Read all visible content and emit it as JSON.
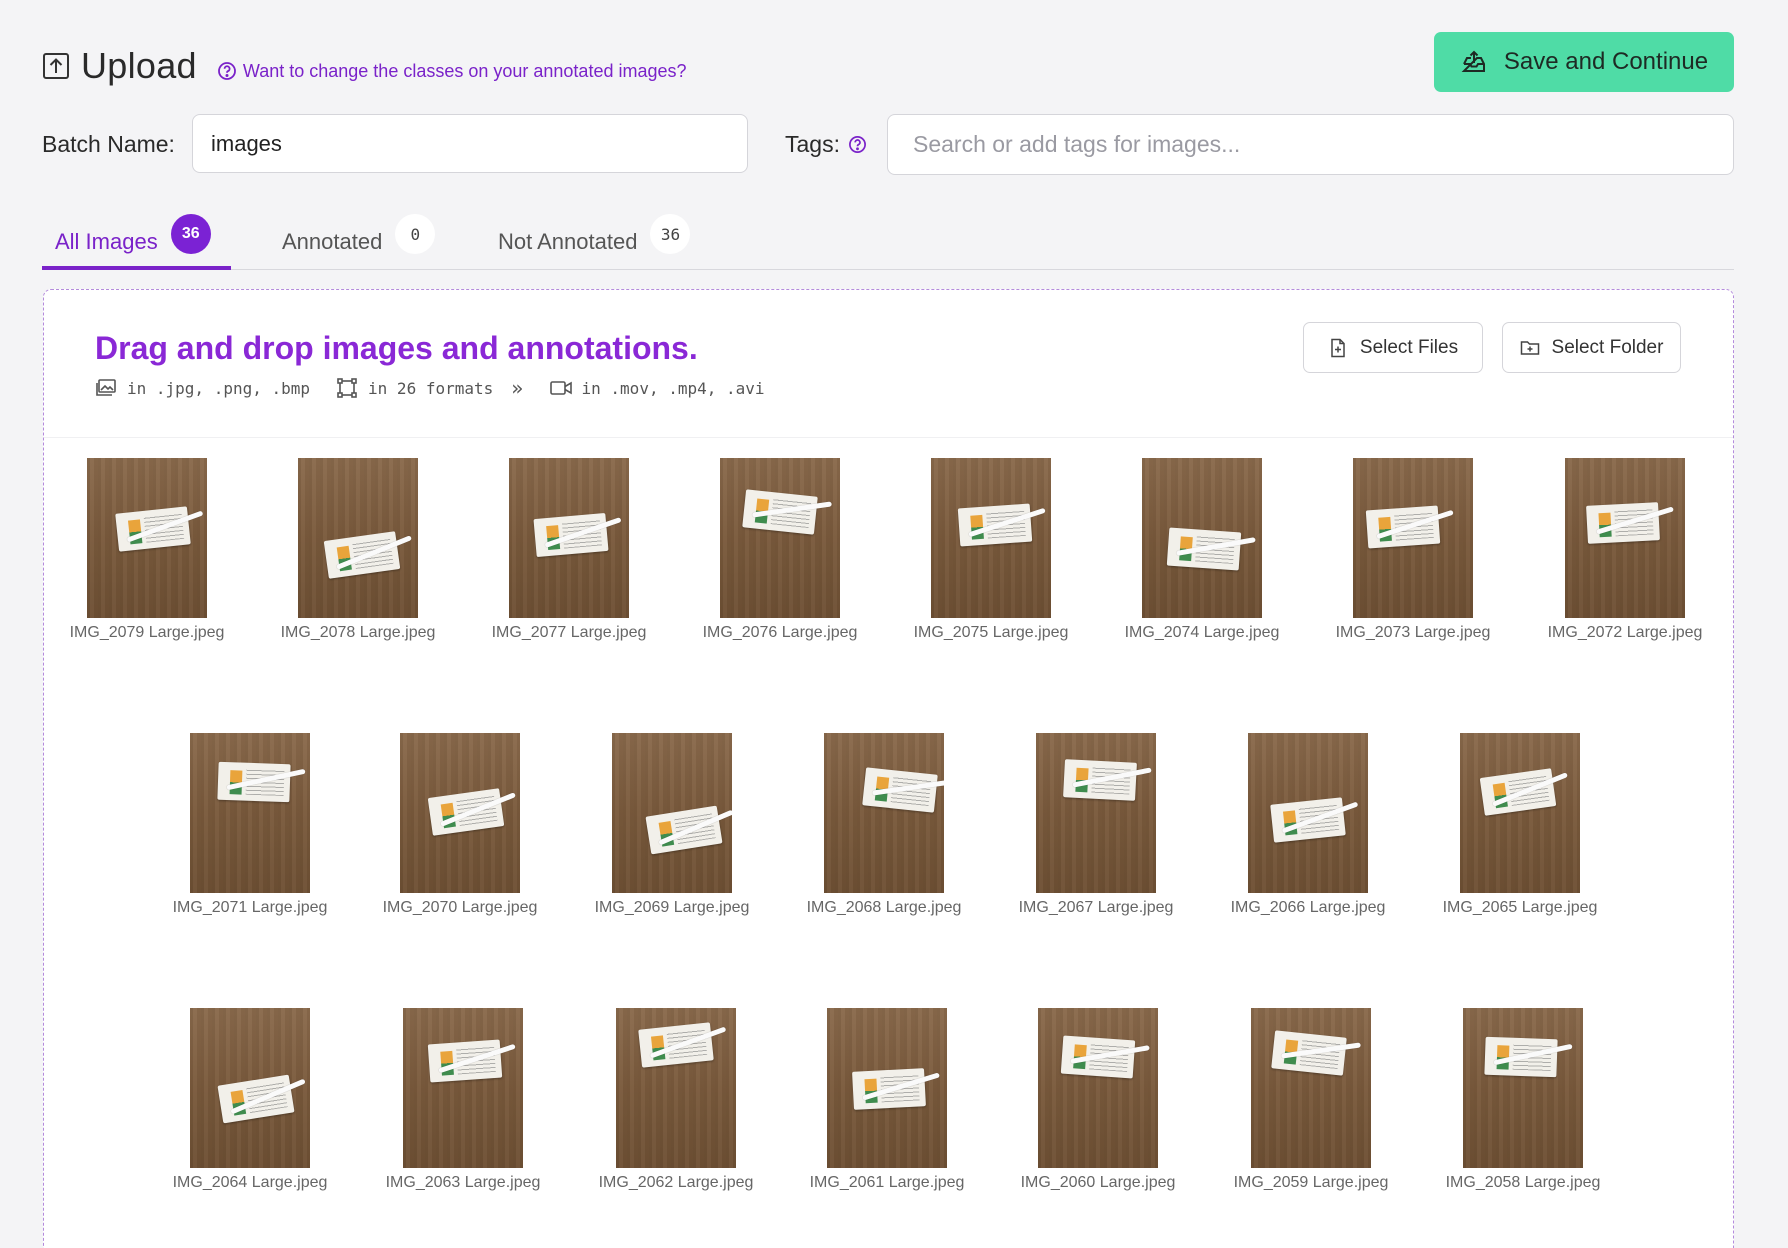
{
  "header": {
    "title": "Upload",
    "help_link": "Want to change the classes on your annotated images?",
    "save_button": "Save and Continue"
  },
  "batch": {
    "label": "Batch Name:",
    "value": "images"
  },
  "tags": {
    "label": "Tags:",
    "placeholder": "Search or add tags for images..."
  },
  "tabs": [
    {
      "label": "All Images",
      "count": "36",
      "active": true
    },
    {
      "label": "Annotated",
      "count": "0",
      "active": false
    },
    {
      "label": "Not Annotated",
      "count": "36",
      "active": false
    }
  ],
  "dropzone": {
    "title": "Drag and drop images and annotations.",
    "image_formats": "in .jpg, .png, .bmp",
    "annotation_formats": "in 26 formats",
    "video_formats": "in .mov, .mp4, .avi",
    "select_files": "Select Files",
    "select_folder": "Select Folder"
  },
  "images": [
    "IMG_2079 Large.jpeg",
    "IMG_2078 Large.jpeg",
    "IMG_2077 Large.jpeg",
    "IMG_2076 Large.jpeg",
    "IMG_2075 Large.jpeg",
    "IMG_2074 Large.jpeg",
    "IMG_2073 Large.jpeg",
    "IMG_2072 Large.jpeg",
    "IMG_2071 Large.jpeg",
    "IMG_2070 Large.jpeg",
    "IMG_2069 Large.jpeg",
    "IMG_2068 Large.jpeg",
    "IMG_2067 Large.jpeg",
    "IMG_2066 Large.jpeg",
    "IMG_2065 Large.jpeg",
    "IMG_2064 Large.jpeg",
    "IMG_2063 Large.jpeg",
    "IMG_2062 Large.jpeg",
    "IMG_2061 Large.jpeg",
    "IMG_2060 Large.jpeg",
    "IMG_2059 Large.jpeg",
    "IMG_2058 Large.jpeg"
  ],
  "colors": {
    "accent": "#7a22c9",
    "save_button": "#4fdca6"
  }
}
